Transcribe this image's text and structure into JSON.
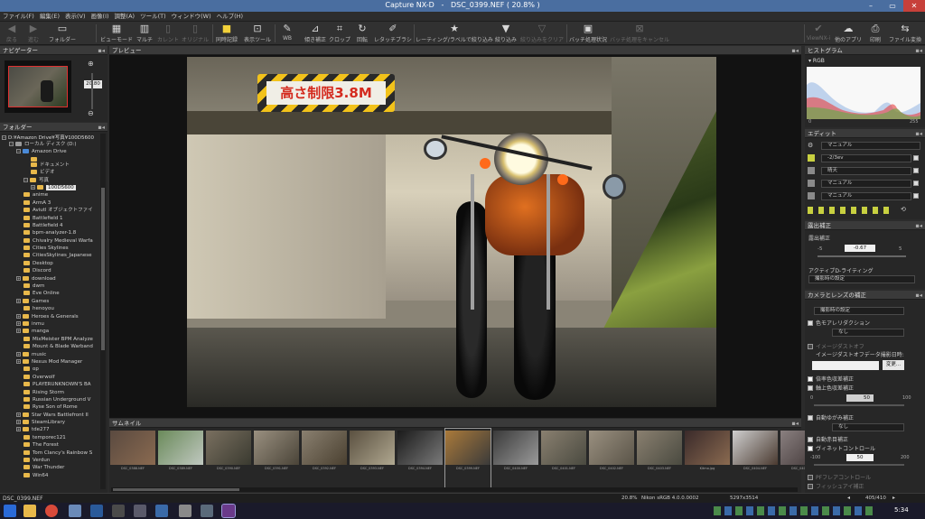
{
  "window": {
    "title": "Capture NX-D",
    "file": "DSC_0399.NEF ( 20.8% )"
  },
  "menu": [
    "ファイル(F)",
    "編集(E)",
    "表示(V)",
    "画像(I)",
    "調整(A)",
    "ツール(T)",
    "ウィンドウ(W)",
    "ヘルプ(H)"
  ],
  "toolbar": {
    "back": "戻る",
    "forward": "進む",
    "folder": "フォルダー",
    "viewer": "ビューモード",
    "multi": "マルチ",
    "current": "カレント",
    "original": "オリジナル",
    "sync": "同時記録",
    "display_tools": "表示ツール",
    "wb": "WB",
    "level": "傾き補正",
    "crop": "クロップ",
    "rotate": "回転",
    "retouch": "レタッチブラシ",
    "rating": "レーティング/ラベルで絞り込み",
    "filter": "絞り込み",
    "clear_filter": "絞り込みをクリア",
    "batch_status": "バッチ処理状況",
    "batch_cancel": "バッチ処理をキャンセル",
    "viewnx": "ViewNX-i",
    "other_apps": "他のアプリ",
    "print": "印刷",
    "file_convert": "ファイル変換"
  },
  "navigator": {
    "title": "ナビゲーター",
    "zoom": "20.80"
  },
  "folders": {
    "title": "フォルダー",
    "path": "D:¥Amazon Drive¥写真¥100D5600",
    "items": [
      "ローカル ディスク (D:)",
      "Amazon Drive",
      "ドキュメント",
      "ビデオ",
      "写真",
      "100D5600",
      "anime",
      "ArmA 3",
      "Aviutl オブジェクトファイ",
      "Battlefield 1",
      "Battlefield 4",
      "bpm-analyzer-1.8",
      "Chivalry Medieval Warfa",
      "Cities Skylines",
      "CitiesSkylines_Japanese",
      "Desktop",
      "Discord",
      "download",
      "dwm",
      "Eve Online",
      "Games",
      "henoyou",
      "Heroes & Generals",
      "inmu",
      "manga",
      "MixMeister BPM Analyze",
      "Mount & Blade Warband",
      "music",
      "Nexus Mod Manager",
      "op",
      "Overwolf",
      "PLAYERUNKNOWN'S BA",
      "Rising Storm",
      "Russian Underground V",
      "Ryse Son of Rome",
      "Star Wars Battlefront II",
      "SteamLibrary",
      "tde277",
      "temporec121",
      "The Forest",
      "Tom Clancy's Rainbow S",
      "Verdun",
      "War Thunder",
      "Win64"
    ]
  },
  "preview": {
    "title": "プレビュー",
    "sign_text": "高さ制限3.8M"
  },
  "thumbnails": {
    "title": "サムネイル",
    "items": [
      {
        "name": "DSC_0388.NEF",
        "colors": [
          "#5a4a40",
          "#8a6a50"
        ]
      },
      {
        "name": "DSC_0389.NEF",
        "colors": [
          "#6a8a5a",
          "#c0c8c0"
        ]
      },
      {
        "name": "DSC_0390.NEF",
        "colors": [
          "#7a7060",
          "#3a3a30"
        ]
      },
      {
        "name": "DSC_0391.NEF",
        "colors": [
          "#9a9080",
          "#4a4438"
        ]
      },
      {
        "name": "DSC_0392.NEF",
        "colors": [
          "#8a8070",
          "#4a4030"
        ]
      },
      {
        "name": "DSC_0393.NEF",
        "colors": [
          "#5a5040",
          "#b0a890"
        ]
      },
      {
        "name": "DSC_0394.NEF",
        "colors": [
          "#1a1a1a",
          "#7a7a7a"
        ]
      },
      {
        "name": "DSC_0399.NEF",
        "colors": [
          "#aa7a3a",
          "#3a3a3a"
        ]
      },
      {
        "name": "DSC_0400.NEF",
        "colors": [
          "#3a3a3a",
          "#9a9a9a"
        ]
      },
      {
        "name": "DSC_0401.NEF",
        "colors": [
          "#8a8070",
          "#4a4a40"
        ]
      },
      {
        "name": "DSC_0402.NEF",
        "colors": [
          "#9a9080",
          "#5a5448"
        ]
      },
      {
        "name": "DSC_0403.NEF",
        "colors": [
          "#8a8070",
          "#4a4a40"
        ]
      },
      {
        "name": "Kitmo.jpg",
        "colors": [
          "#3a2a2a",
          "#8a6a50"
        ]
      },
      {
        "name": "DSC_0404.NEF",
        "colors": [
          "#cfcfcf",
          "#4a3a30"
        ]
      },
      {
        "name": "DSC_0405.NEF",
        "colors": [
          "#8a8080",
          "#3a3030"
        ]
      }
    ]
  },
  "histogram": {
    "title": "ヒストグラム",
    "channel": "RGB",
    "min": "0",
    "max": "255"
  },
  "edit": {
    "title": "エディット",
    "rows": [
      "マニュアル",
      "-2/3ev",
      "晴天",
      "マニュアル",
      "マニュアル"
    ]
  },
  "exposure": {
    "title": "露出補正",
    "label": "露出補正",
    "min": "-5",
    "value": "-0.67",
    "max": "5",
    "ad_label": "アクティブD-ライティング",
    "ad_value": "撮影時の設定"
  },
  "lens": {
    "title": "カメラとレンズの補正",
    "shot_setting": "撮影時の設定",
    "color_moire": "色モアレリダクション",
    "none": "なし",
    "dust_off": "イメージダストオフ",
    "dust_ref": "イメージダストオフデータ撮影日時:",
    "change": "変更...",
    "ca": "倍率色収差補正",
    "axial": "軸上色収差補正",
    "axial_min": "0",
    "axial_val": "50",
    "axial_max": "100",
    "distortion": "自動ゆがみ補正",
    "distortion_val": "なし",
    "red_eye": "自動赤目補正",
    "vignette": "ヴィネットコントロール",
    "vig_min": "-100",
    "vig_val": "50",
    "vig_max": "200",
    "pf": "PFフレアコントロール",
    "fisheye": "フィッシュアイ補正"
  },
  "status": {
    "file": "DSC_0399.NEF",
    "zoom": "20.8%",
    "profile": "Nikon sRGB 4.0.0.0002",
    "dims": "5297x3514",
    "index": "405/410"
  },
  "taskbar": {
    "time": "5:34"
  }
}
